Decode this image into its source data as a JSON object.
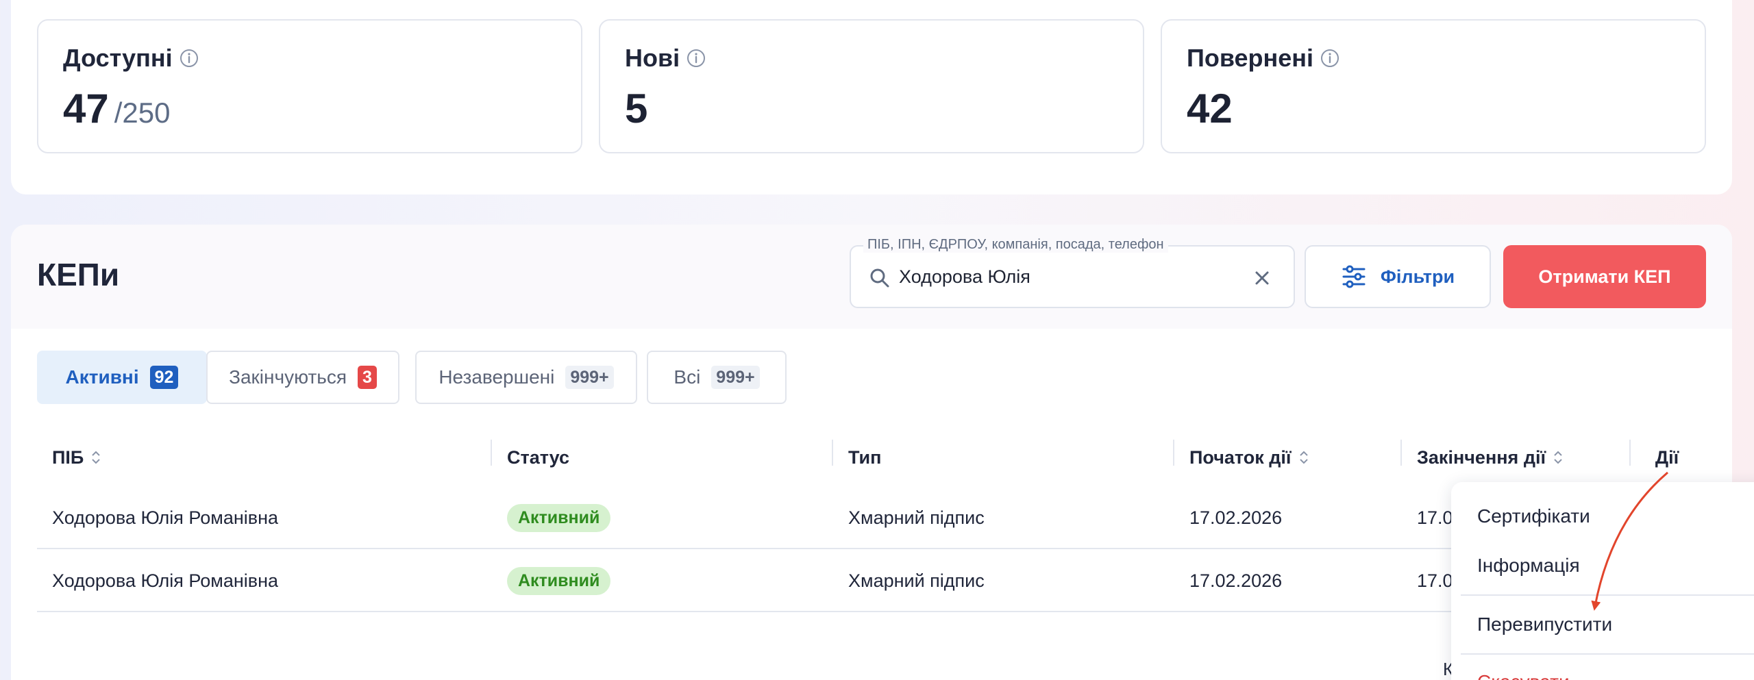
{
  "stats": [
    {
      "title": "Доступні",
      "value": "47",
      "total": "/250"
    },
    {
      "title": "Нові",
      "value": "5"
    },
    {
      "title": "Повернені",
      "value": "42"
    }
  ],
  "kep": {
    "title": "КЕПи",
    "search": {
      "label": "ПІБ, ІПН, ЄДРПОУ, компанія, посада, телефон",
      "value": "Ходорова Юлія"
    },
    "filter_label": "Фільтри",
    "get_kep_label": "Отримати КЕП"
  },
  "tabs": [
    {
      "label": "Активні",
      "count": "92"
    },
    {
      "label": "Закінчуються",
      "count": "3"
    },
    {
      "label": "Незавершені",
      "count": "999+"
    },
    {
      "label": "Всі",
      "count": "999+"
    }
  ],
  "table": {
    "headers": [
      "ПІБ",
      "Статус",
      "Тип",
      "Початок дії",
      "Закінчення дії",
      "Дії"
    ],
    "rows": [
      {
        "name": "Ходорова Юлія Романівна",
        "status": "Активний",
        "type": "Хмарний підпис",
        "start": "17.02.2026",
        "end": "17.0"
      },
      {
        "name": "Ходорова Юлія Романівна",
        "status": "Активний",
        "type": "Хмарний підпис",
        "start": "17.02.2026",
        "end": "17.0"
      }
    ]
  },
  "actions_menu": {
    "items": [
      "Сертифікати",
      "Інформація",
      "Перевипустити",
      "Скасувати"
    ]
  },
  "footer_peek": "К",
  "colors": {
    "accent": "#1f5fbf",
    "primary_button": "#f25a5e",
    "status_active_bg": "#d6f1cf",
    "status_active_text": "#2f8c1f",
    "annotation_arrow": "#e2452c"
  }
}
